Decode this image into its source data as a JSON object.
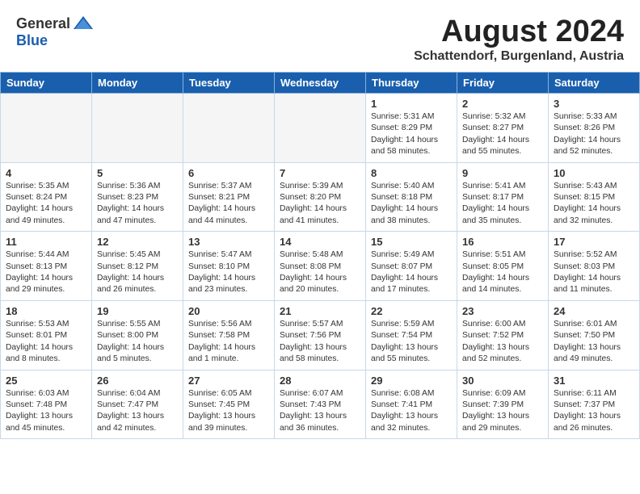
{
  "header": {
    "logo_general": "General",
    "logo_blue": "Blue",
    "month_year": "August 2024",
    "location": "Schattendorf, Burgenland, Austria"
  },
  "days_of_week": [
    "Sunday",
    "Monday",
    "Tuesday",
    "Wednesday",
    "Thursday",
    "Friday",
    "Saturday"
  ],
  "weeks": [
    [
      {
        "day": "",
        "content": ""
      },
      {
        "day": "",
        "content": ""
      },
      {
        "day": "",
        "content": ""
      },
      {
        "day": "",
        "content": ""
      },
      {
        "day": "1",
        "content": "Sunrise: 5:31 AM\nSunset: 8:29 PM\nDaylight: 14 hours\nand 58 minutes."
      },
      {
        "day": "2",
        "content": "Sunrise: 5:32 AM\nSunset: 8:27 PM\nDaylight: 14 hours\nand 55 minutes."
      },
      {
        "day": "3",
        "content": "Sunrise: 5:33 AM\nSunset: 8:26 PM\nDaylight: 14 hours\nand 52 minutes."
      }
    ],
    [
      {
        "day": "4",
        "content": "Sunrise: 5:35 AM\nSunset: 8:24 PM\nDaylight: 14 hours\nand 49 minutes."
      },
      {
        "day": "5",
        "content": "Sunrise: 5:36 AM\nSunset: 8:23 PM\nDaylight: 14 hours\nand 47 minutes."
      },
      {
        "day": "6",
        "content": "Sunrise: 5:37 AM\nSunset: 8:21 PM\nDaylight: 14 hours\nand 44 minutes."
      },
      {
        "day": "7",
        "content": "Sunrise: 5:39 AM\nSunset: 8:20 PM\nDaylight: 14 hours\nand 41 minutes."
      },
      {
        "day": "8",
        "content": "Sunrise: 5:40 AM\nSunset: 8:18 PM\nDaylight: 14 hours\nand 38 minutes."
      },
      {
        "day": "9",
        "content": "Sunrise: 5:41 AM\nSunset: 8:17 PM\nDaylight: 14 hours\nand 35 minutes."
      },
      {
        "day": "10",
        "content": "Sunrise: 5:43 AM\nSunset: 8:15 PM\nDaylight: 14 hours\nand 32 minutes."
      }
    ],
    [
      {
        "day": "11",
        "content": "Sunrise: 5:44 AM\nSunset: 8:13 PM\nDaylight: 14 hours\nand 29 minutes."
      },
      {
        "day": "12",
        "content": "Sunrise: 5:45 AM\nSunset: 8:12 PM\nDaylight: 14 hours\nand 26 minutes."
      },
      {
        "day": "13",
        "content": "Sunrise: 5:47 AM\nSunset: 8:10 PM\nDaylight: 14 hours\nand 23 minutes."
      },
      {
        "day": "14",
        "content": "Sunrise: 5:48 AM\nSunset: 8:08 PM\nDaylight: 14 hours\nand 20 minutes."
      },
      {
        "day": "15",
        "content": "Sunrise: 5:49 AM\nSunset: 8:07 PM\nDaylight: 14 hours\nand 17 minutes."
      },
      {
        "day": "16",
        "content": "Sunrise: 5:51 AM\nSunset: 8:05 PM\nDaylight: 14 hours\nand 14 minutes."
      },
      {
        "day": "17",
        "content": "Sunrise: 5:52 AM\nSunset: 8:03 PM\nDaylight: 14 hours\nand 11 minutes."
      }
    ],
    [
      {
        "day": "18",
        "content": "Sunrise: 5:53 AM\nSunset: 8:01 PM\nDaylight: 14 hours\nand 8 minutes."
      },
      {
        "day": "19",
        "content": "Sunrise: 5:55 AM\nSunset: 8:00 PM\nDaylight: 14 hours\nand 5 minutes."
      },
      {
        "day": "20",
        "content": "Sunrise: 5:56 AM\nSunset: 7:58 PM\nDaylight: 14 hours\nand 1 minute."
      },
      {
        "day": "21",
        "content": "Sunrise: 5:57 AM\nSunset: 7:56 PM\nDaylight: 13 hours\nand 58 minutes."
      },
      {
        "day": "22",
        "content": "Sunrise: 5:59 AM\nSunset: 7:54 PM\nDaylight: 13 hours\nand 55 minutes."
      },
      {
        "day": "23",
        "content": "Sunrise: 6:00 AM\nSunset: 7:52 PM\nDaylight: 13 hours\nand 52 minutes."
      },
      {
        "day": "24",
        "content": "Sunrise: 6:01 AM\nSunset: 7:50 PM\nDaylight: 13 hours\nand 49 minutes."
      }
    ],
    [
      {
        "day": "25",
        "content": "Sunrise: 6:03 AM\nSunset: 7:48 PM\nDaylight: 13 hours\nand 45 minutes."
      },
      {
        "day": "26",
        "content": "Sunrise: 6:04 AM\nSunset: 7:47 PM\nDaylight: 13 hours\nand 42 minutes."
      },
      {
        "day": "27",
        "content": "Sunrise: 6:05 AM\nSunset: 7:45 PM\nDaylight: 13 hours\nand 39 minutes."
      },
      {
        "day": "28",
        "content": "Sunrise: 6:07 AM\nSunset: 7:43 PM\nDaylight: 13 hours\nand 36 minutes."
      },
      {
        "day": "29",
        "content": "Sunrise: 6:08 AM\nSunset: 7:41 PM\nDaylight: 13 hours\nand 32 minutes."
      },
      {
        "day": "30",
        "content": "Sunrise: 6:09 AM\nSunset: 7:39 PM\nDaylight: 13 hours\nand 29 minutes."
      },
      {
        "day": "31",
        "content": "Sunrise: 6:11 AM\nSunset: 7:37 PM\nDaylight: 13 hours\nand 26 minutes."
      }
    ]
  ]
}
